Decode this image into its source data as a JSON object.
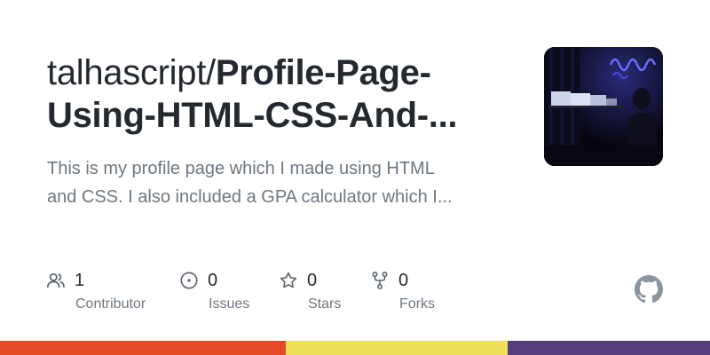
{
  "repo": {
    "owner": "talhascript/",
    "name": "Profile-Page-Using-HTML-CSS-And-...",
    "name_line1": "Profile-Page-",
    "name_line2": "Using-HTML-CSS-And-...",
    "description_line1": "This is my profile page which I made using HTML",
    "description_line2": "and CSS. I also included a GPA calculator which I..."
  },
  "stats": [
    {
      "value": "1",
      "label": "Contributor",
      "icon": "people-icon"
    },
    {
      "value": "0",
      "label": "Issues",
      "icon": "issue-opened-icon"
    },
    {
      "value": "0",
      "label": "Stars",
      "icon": "star-icon"
    },
    {
      "value": "0",
      "label": "Forks",
      "icon": "repo-forked-icon"
    }
  ],
  "colors": {
    "text": "#24292f",
    "muted": "#6e7781",
    "stripe": [
      "#e34c26",
      "#f1e05a",
      "#563d7c"
    ]
  },
  "language_bar": [
    {
      "color": "#e34c26",
      "share": 0.403
    },
    {
      "color": "#f1e05a",
      "share": 0.312
    },
    {
      "color": "#563d7c",
      "share": 0.285
    }
  ],
  "logo": "github-mark-icon"
}
